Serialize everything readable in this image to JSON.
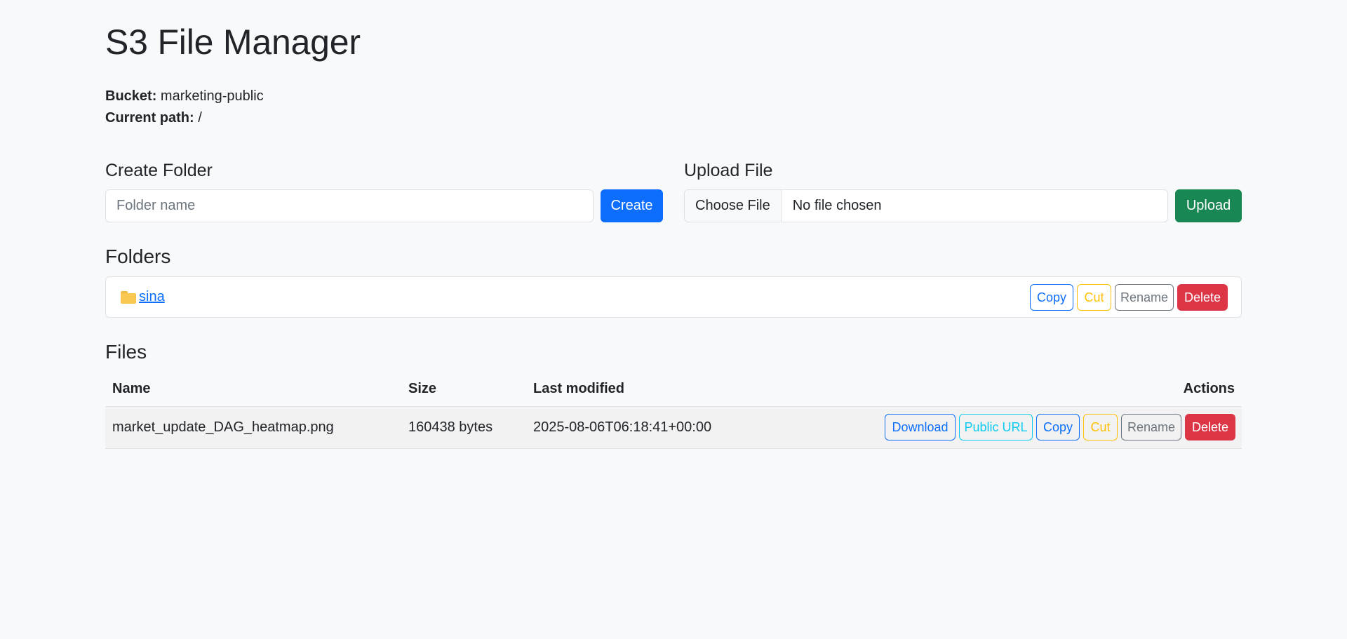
{
  "header": {
    "title": "S3 File Manager",
    "bucket_label": "Bucket:",
    "bucket_value": "marketing-public",
    "path_label": "Current path:",
    "path_value": "/"
  },
  "create_folder": {
    "heading": "Create Folder",
    "placeholder": "Folder name",
    "value": "",
    "button": "Create"
  },
  "upload": {
    "heading": "Upload File",
    "choose_label": "Choose File",
    "status": "No file chosen",
    "button": "Upload"
  },
  "folders": {
    "heading": "Folders",
    "items": [
      {
        "name": "sina",
        "icon": "folder-icon",
        "actions": [
          "Copy",
          "Cut",
          "Rename",
          "Delete"
        ]
      }
    ]
  },
  "files": {
    "heading": "Files",
    "columns": [
      "Name",
      "Size",
      "Last modified",
      "Actions"
    ],
    "rows": [
      {
        "name": "market_update_DAG_heatmap.png",
        "size": "160438 bytes",
        "modified": "2025-08-06T06:18:41+00:00",
        "actions": [
          "Download",
          "Public URL",
          "Copy",
          "Cut",
          "Rename",
          "Delete"
        ]
      }
    ]
  },
  "colors": {
    "primary": "#0d6efd",
    "success": "#198754",
    "danger": "#dc3545",
    "warning": "#ffc107",
    "info": "#0dcaf0",
    "secondary": "#6c757d",
    "background": "#f8f9fa"
  }
}
